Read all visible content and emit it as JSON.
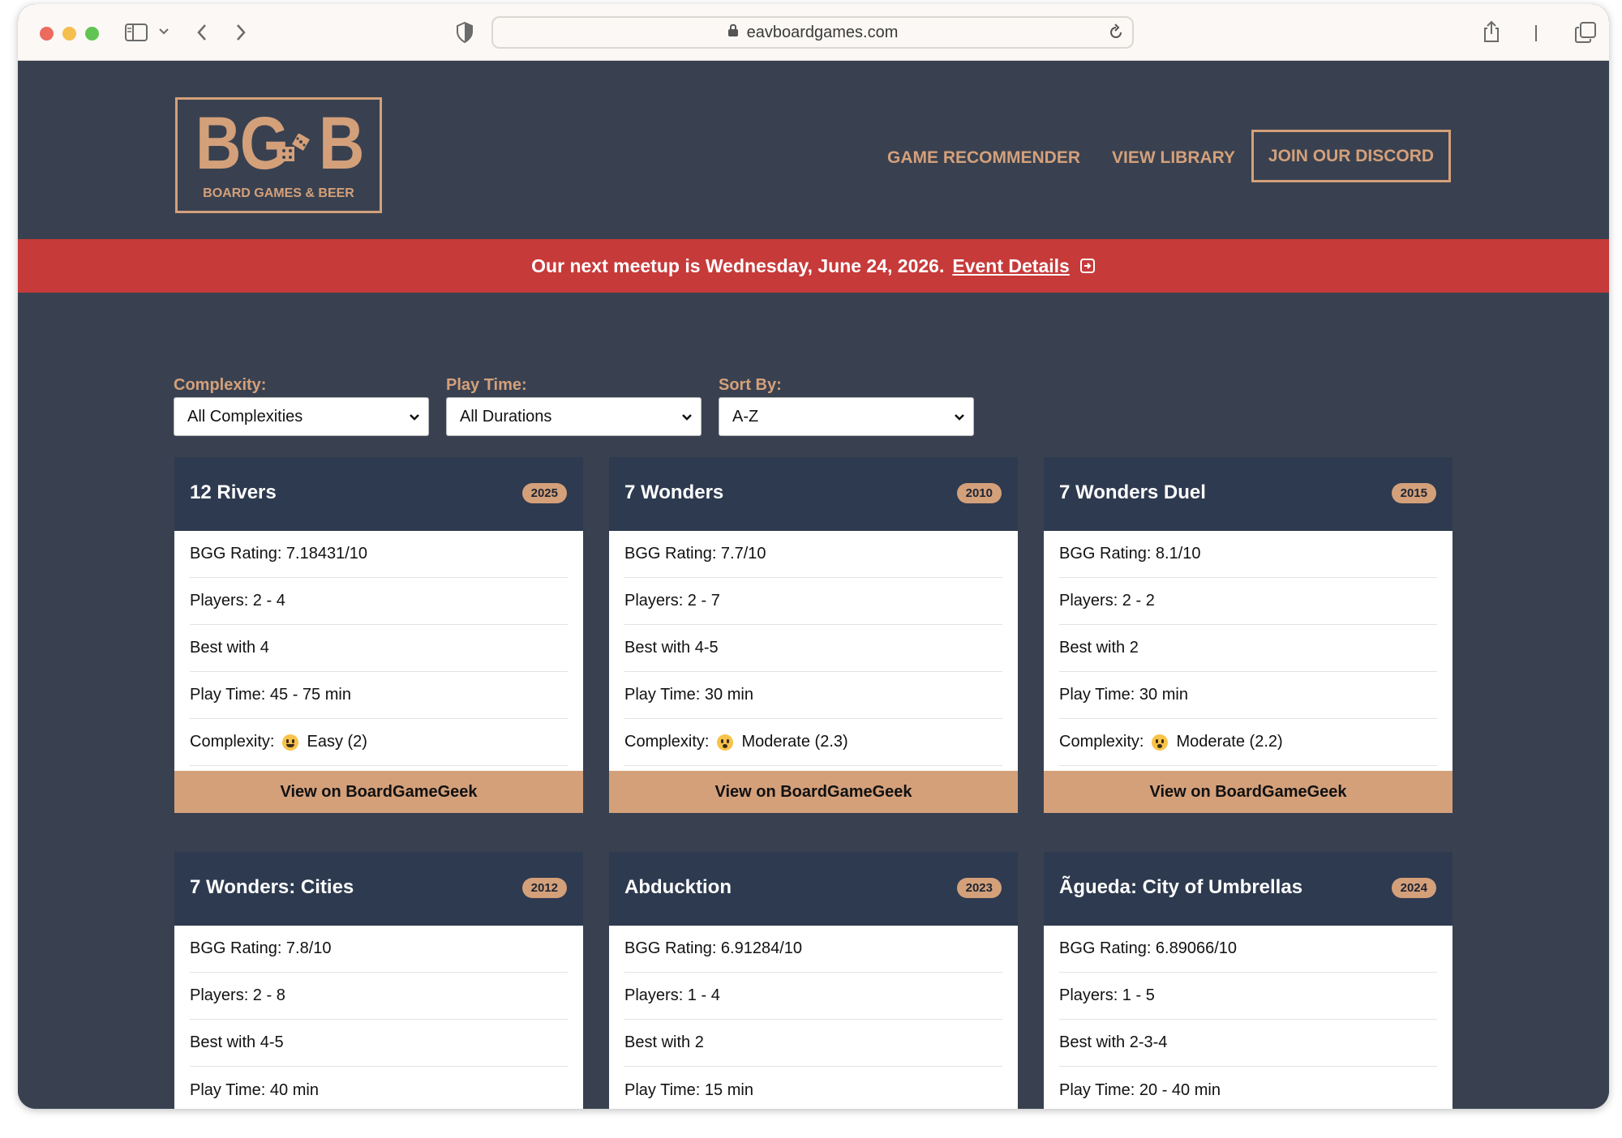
{
  "browser": {
    "url": "eavboardgames.com"
  },
  "header": {
    "logo_letters_left": "BG",
    "logo_letter_right": "B",
    "logo_subtitle": "BOARD GAMES & BEER",
    "nav": [
      {
        "label": "GAME RECOMMENDER"
      },
      {
        "label": "VIEW LIBRARY"
      }
    ],
    "discord_label": "JOIN OUR DISCORD"
  },
  "banner": {
    "text": "Our next meetup is Wednesday, June 24, 2026.",
    "link_label": "Event Details",
    "color": "#c73a3a"
  },
  "filters": {
    "complexity": {
      "label": "Complexity:",
      "value": "All Complexities"
    },
    "play_time": {
      "label": "Play Time:",
      "value": "All Durations"
    },
    "sort_by": {
      "label": "Sort By:",
      "value": "A-Z"
    }
  },
  "colors": {
    "accent": "#d4a07a",
    "background": "#394150",
    "card_header": "#2e3a4f"
  },
  "games": [
    {
      "title": "12 Rivers",
      "year": "2025",
      "rows": [
        "BGG Rating: 7.18431/10",
        "Players: 2 - 4",
        "Best with 4",
        "Play Time: 45 - 75 min"
      ],
      "complexity_label": "Complexity:",
      "complexity_icon": "grinning-face-icon",
      "complexity_value": "Easy (2)",
      "button": "View on BoardGameGeek"
    },
    {
      "title": "7 Wonders",
      "year": "2010",
      "rows": [
        "BGG Rating: 7.7/10",
        "Players: 2 - 7",
        "Best with 4-5",
        "Play Time: 30 min"
      ],
      "complexity_label": "Complexity:",
      "complexity_icon": "thinking-face-icon",
      "complexity_value": "Moderate (2.3)",
      "button": "View on BoardGameGeek"
    },
    {
      "title": "7 Wonders Duel",
      "year": "2015",
      "rows": [
        "BGG Rating: 8.1/10",
        "Players: 2 - 2",
        "Best with 2",
        "Play Time: 30 min"
      ],
      "complexity_label": "Complexity:",
      "complexity_icon": "thinking-face-icon",
      "complexity_value": "Moderate (2.2)",
      "button": "View on BoardGameGeek"
    },
    {
      "title": "7 Wonders: Cities",
      "year": "2012",
      "rows": [
        "BGG Rating: 7.8/10",
        "Players: 2 - 8",
        "Best with 4-5",
        "Play Time: 40 min"
      ]
    },
    {
      "title": "Abducktion",
      "year": "2023",
      "rows": [
        "BGG Rating: 6.91284/10",
        "Players: 1 - 4",
        "Best with 2",
        "Play Time: 15 min"
      ]
    },
    {
      "title": "Ãgueda: City of Umbrellas",
      "year": "2024",
      "rows": [
        "BGG Rating: 6.89066/10",
        "Players: 1 - 5",
        "Best with 2-3-4",
        "Play Time: 20 - 40 min"
      ]
    }
  ]
}
